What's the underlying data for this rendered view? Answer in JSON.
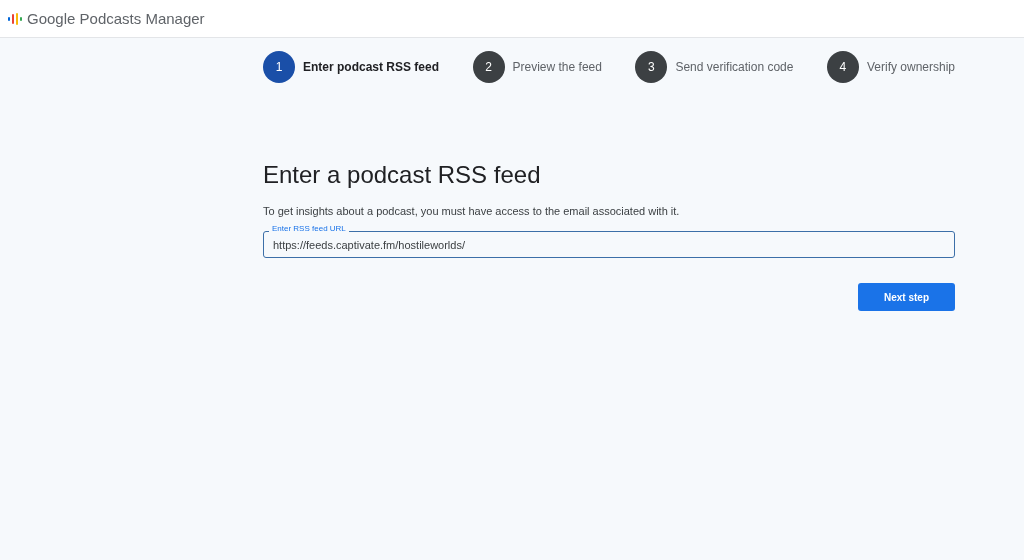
{
  "header": {
    "title": "Google Podcasts Manager"
  },
  "steps": [
    {
      "number": "1",
      "label": "Enter podcast RSS feed",
      "selected": true
    },
    {
      "number": "2",
      "label": "Preview the feed",
      "selected": false
    },
    {
      "number": "3",
      "label": "Send verification code",
      "selected": false
    },
    {
      "number": "4",
      "label": "Verify ownership",
      "selected": false
    }
  ],
  "heading": "Enter a podcast RSS feed",
  "description": "To get insights about a podcast, you must have access to the email associated with it.",
  "rss_field": {
    "label": "Enter RSS feed URL",
    "value": "https://feeds.captivate.fm/hostileworlds/"
  },
  "next_button": "Next step"
}
